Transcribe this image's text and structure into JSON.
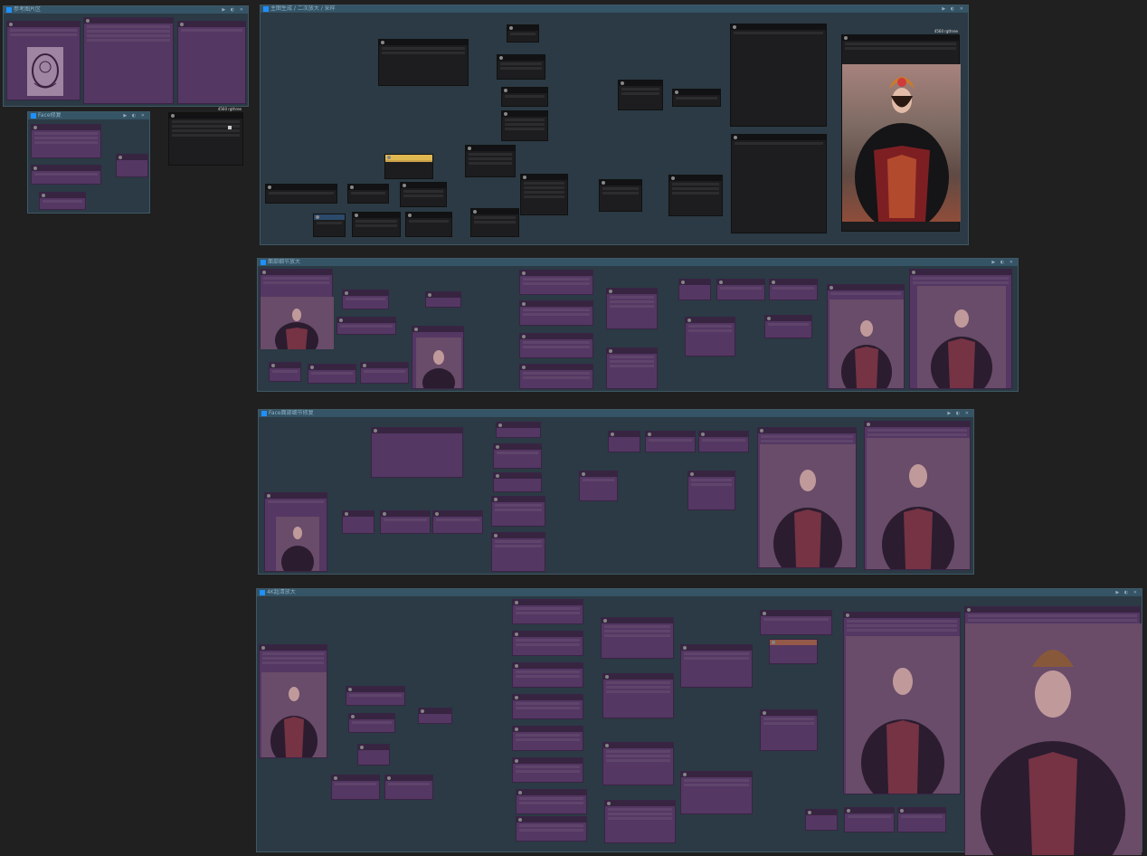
{
  "groups": [
    {
      "id": "g-top-left-1",
      "title": "参考图片区",
      "tools": "▶ ◐ ✕"
    },
    {
      "id": "g-top-left-2",
      "title": "Face修复",
      "tools": "▶ ◐ ✕"
    },
    {
      "id": "g-main",
      "title": "主图生成 / 二次放大 / 采样",
      "tools": "▶ ◐ ✕"
    },
    {
      "id": "g-2",
      "title": "面部细节放大",
      "tools": "▶ ◐ ✕"
    },
    {
      "id": "g-3",
      "title": "Face面部细节修复",
      "tools": "▶ ◐ ✕"
    },
    {
      "id": "g-4",
      "title": "4K超清放大",
      "tools": "▶ ◐ ✕"
    }
  ],
  "badges": {
    "save": "4560 rgthree"
  },
  "colors": {
    "wire_blue": "#6ab7e8",
    "wire_pink": "#e57ad6",
    "wire_green": "#6be07a",
    "wire_yellow": "#f4d03f",
    "wire_orange": "#f39c12"
  }
}
